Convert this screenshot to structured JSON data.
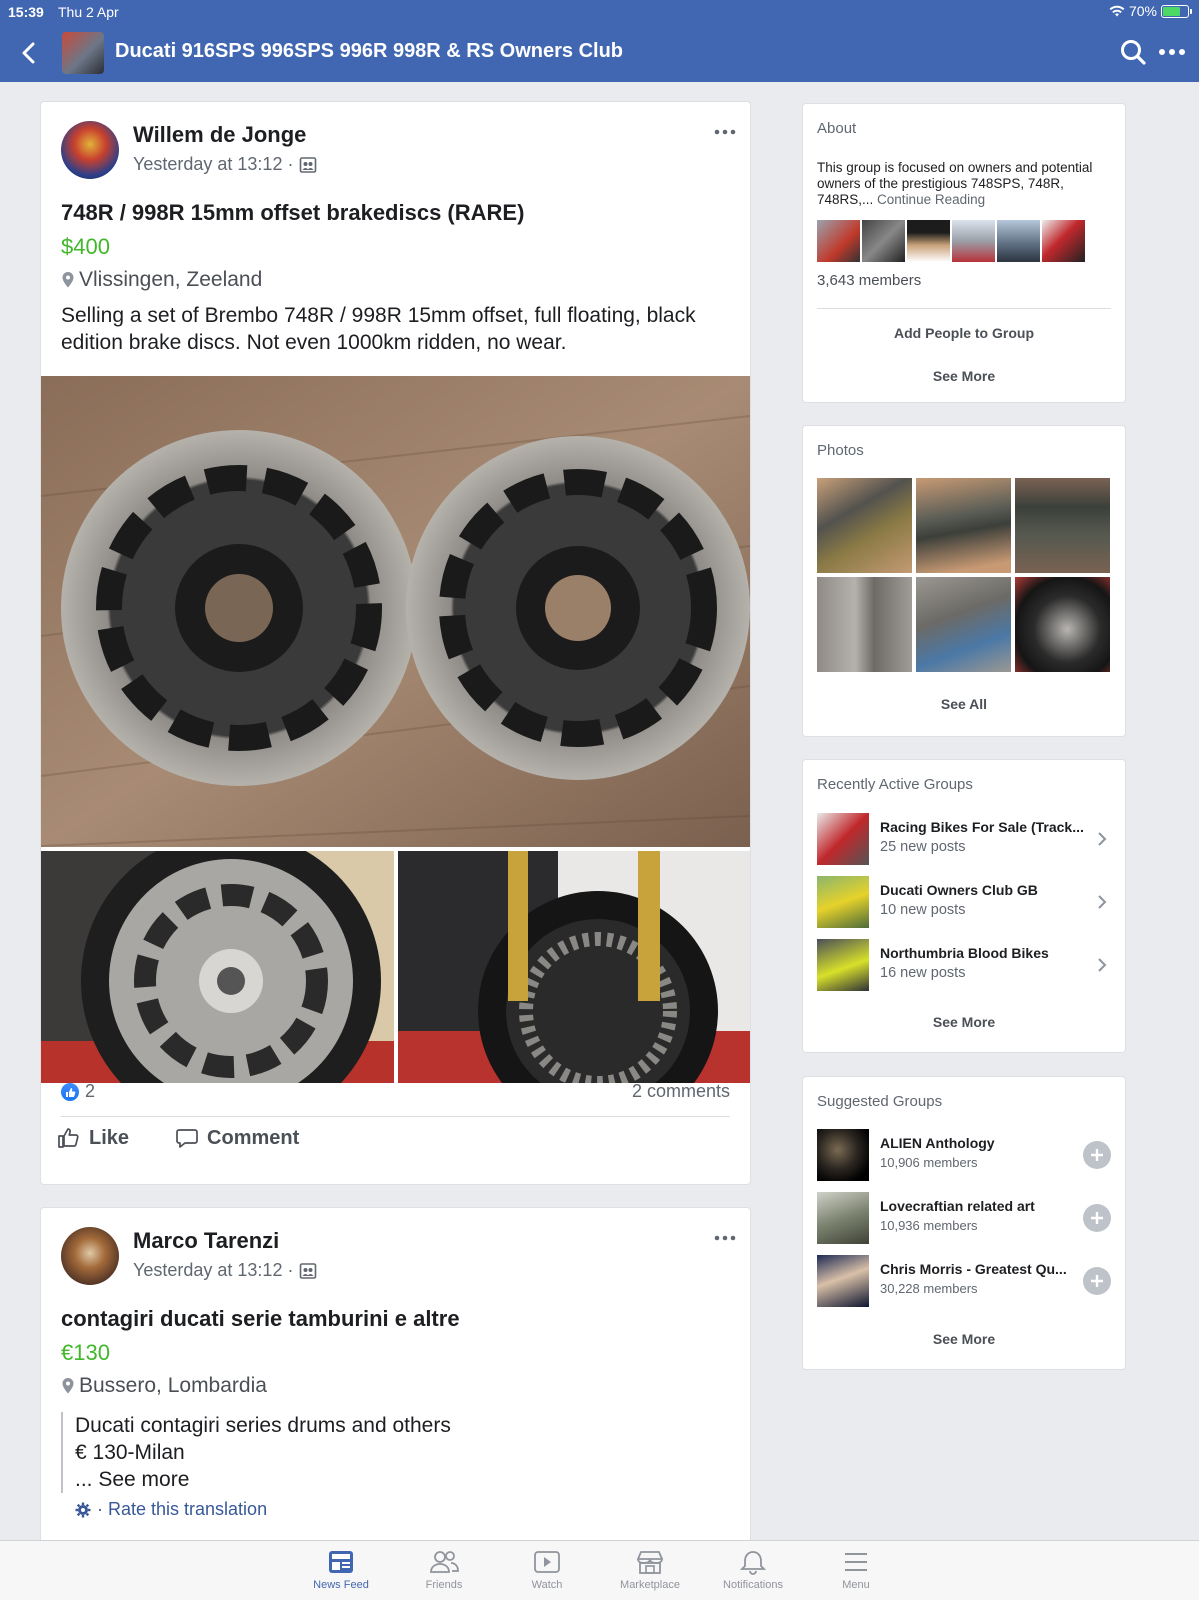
{
  "status": {
    "time": "15:39",
    "date": "Thu 2 Apr",
    "battery": "70%"
  },
  "header": {
    "title": "Ducati 916SPS 996SPS 996R 998R & RS Owners Club"
  },
  "posts": [
    {
      "author": "Willem de Jonge",
      "time": "Yesterday at 13:12 ·",
      "title": "748R / 998R 15mm offset brakediscs (RARE)",
      "price": "$400",
      "location": "Vlissingen, Zeeland",
      "body": "Selling a set of Brembo 748R / 998R 15mm offset, full floating, black edition brake discs. Not even 1000km ridden, no wear.",
      "likes": "2",
      "comments": "2 comments",
      "like_label": "Like",
      "comment_label": "Comment"
    },
    {
      "author": "Marco Tarenzi",
      "time": "Yesterday at 13:12 ·",
      "title": "contagiri ducati serie tamburini e altre",
      "price": "€130",
      "location": "Bussero, Lombardia",
      "body_line1": "Ducati contagiri series drums and others",
      "body_line2": "€ 130-Milan",
      "see_more": "... See more",
      "translate": "· Rate this translation"
    }
  ],
  "about": {
    "title": "About",
    "text": "This group is focused on owners and potential owners of the prestigious 748SPS, 748R, 748RS,...",
    "continue": "Continue Reading",
    "members": "3,643 members",
    "add_people": "Add People to Group",
    "see_more": "See More"
  },
  "photos": {
    "title": "Photos",
    "see_all": "See All"
  },
  "recent_groups": {
    "title": "Recently Active Groups",
    "items": [
      {
        "name": "Racing Bikes For Sale (Track...",
        "sub": "25 new posts"
      },
      {
        "name": "Ducati Owners Club GB",
        "sub": "10 new posts"
      },
      {
        "name": "Northumbria Blood Bikes",
        "sub": "16 new posts"
      }
    ],
    "see_more": "See More"
  },
  "suggested_groups": {
    "title": "Suggested Groups",
    "items": [
      {
        "name": "ALIEN  Anthology",
        "sub": "10,906 members"
      },
      {
        "name": "Lovecraftian related art",
        "sub": "10,936 members"
      },
      {
        "name": "Chris Morris - Greatest Qu...",
        "sub": "30,228 members"
      }
    ],
    "see_more": "See More"
  },
  "tabs": [
    {
      "label": "News Feed",
      "icon": "news-feed-icon"
    },
    {
      "label": "Friends",
      "icon": "friends-icon"
    },
    {
      "label": "Watch",
      "icon": "watch-icon"
    },
    {
      "label": "Marketplace",
      "icon": "marketplace-icon"
    },
    {
      "label": "Notifications",
      "icon": "bell-icon"
    },
    {
      "label": "Menu",
      "icon": "menu-icon"
    }
  ],
  "colors": {
    "brand": "#4267b2",
    "price": "#42b72a",
    "link": "#385898"
  }
}
